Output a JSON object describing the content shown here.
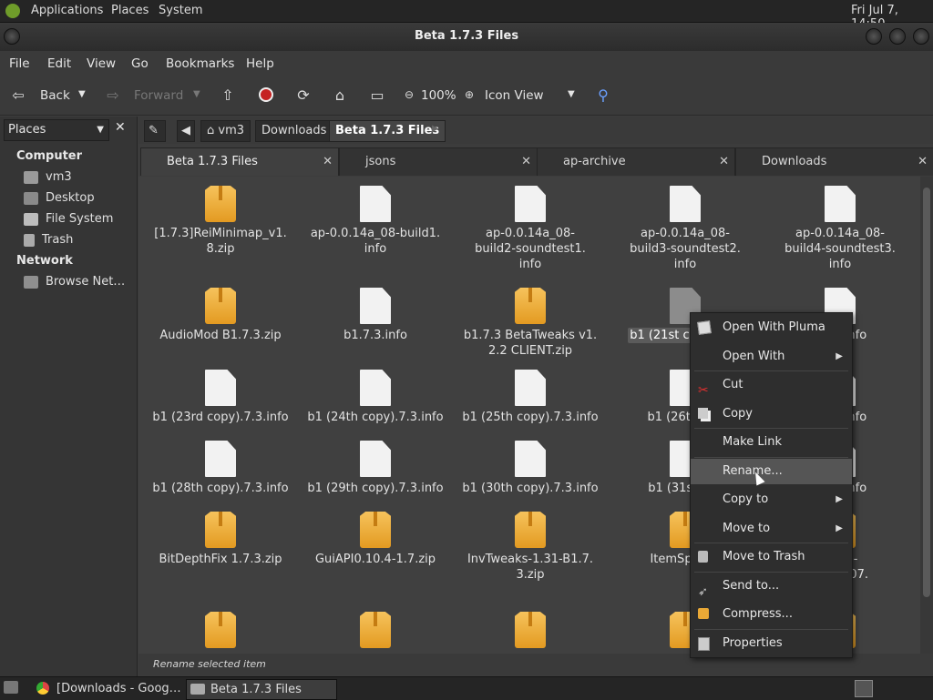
{
  "top_panel": {
    "menus": [
      "Applications",
      "Places",
      "System"
    ],
    "clock": "Fri Jul  7, 14:50"
  },
  "window": {
    "title": "Beta 1.7.3 Files"
  },
  "menubar": [
    "File",
    "Edit",
    "View",
    "Go",
    "Bookmarks",
    "Help"
  ],
  "toolbar": {
    "back": "Back",
    "forward": "Forward",
    "zoom": "100%",
    "view_mode": "Icon View"
  },
  "sidebar": {
    "title": "Places",
    "sections": [
      {
        "heading": "Computer",
        "items": [
          "vm3",
          "Desktop",
          "File System",
          "Trash"
        ]
      },
      {
        "heading": "Network",
        "items": [
          "Browse Net…"
        ]
      }
    ]
  },
  "location": {
    "crumbs": [
      "vm3",
      "Downloads",
      "Beta 1.7.3 Files"
    ]
  },
  "tabs": [
    "Beta 1.7.3 Files",
    "jsons",
    "ap-archive",
    "Downloads"
  ],
  "files": [
    {
      "name": "[1.7.3]ReiMinimap_v1.\n8.zip",
      "type": "zip"
    },
    {
      "name": "ap-0.0.14a_08-build1.\ninfo",
      "type": "doc"
    },
    {
      "name": "ap-0.0.14a_08-\nbuild2-soundtest1.\ninfo",
      "type": "doc"
    },
    {
      "name": "ap-0.0.14a_08-\nbuild3-soundtest2.\ninfo",
      "type": "doc"
    },
    {
      "name": "ap-0.0.14a_08-\nbuild4-soundtest3.\ninfo",
      "type": "doc"
    },
    {
      "name": "AudioMod B1.7.3.zip",
      "type": "zip"
    },
    {
      "name": "b1.7.3.info",
      "type": "doc"
    },
    {
      "name": "b1.7.3 BetaTweaks v1.\n2.2 CLIENT.zip",
      "type": "zip"
    },
    {
      "name": "b1 (21st cop",
      "type": "doc-selected"
    },
    {
      "name": ").7.3.info",
      "type": "doc"
    },
    {
      "name": "b1 (23rd copy).7.3.info",
      "type": "doc"
    },
    {
      "name": "b1 (24th copy).7.3.info",
      "type": "doc"
    },
    {
      "name": "b1 (25th copy).7.3.info",
      "type": "doc"
    },
    {
      "name": "b1 (26th cop",
      "type": "doc"
    },
    {
      "name": ").7.3.info",
      "type": "doc"
    },
    {
      "name": "b1 (28th copy).7.3.info",
      "type": "doc"
    },
    {
      "name": "b1 (29th copy).7.3.info",
      "type": "doc"
    },
    {
      "name": "b1 (30th copy).7.3.info",
      "type": "doc"
    },
    {
      "name": "b1 (31st cop",
      "type": "doc"
    },
    {
      "name": ").7.3.info",
      "type": "doc"
    },
    {
      "name": "BitDepthFix 1.7.3.zip",
      "type": "zip"
    },
    {
      "name": "GuiAPI0.10.4-1.7.zip",
      "type": "zip"
    },
    {
      "name": "InvTweaks-1.31-B1.7.\n3.zip",
      "type": "zip"
    },
    {
      "name": "ItemSpriteA",
      "type": "zip"
    },
    {
      "name": "forge-\n0110907.",
      "type": "zip"
    },
    {
      "name": "",
      "type": "zip"
    },
    {
      "name": "",
      "type": "zip"
    },
    {
      "name": "",
      "type": "zip"
    },
    {
      "name": "",
      "type": "zip"
    },
    {
      "name": "",
      "type": "zip"
    }
  ],
  "context_menu": [
    {
      "label": "Open With Pluma",
      "icon": "pluma-icon",
      "submenu": false
    },
    {
      "label": "Open With",
      "icon": "",
      "submenu": true
    },
    {
      "label": "Cut",
      "icon": "scissors-icon",
      "submenu": false
    },
    {
      "label": "Copy",
      "icon": "copy-icon",
      "submenu": false
    },
    {
      "label": "Make Link",
      "icon": "",
      "submenu": false
    },
    {
      "label": "Rename...",
      "icon": "",
      "submenu": false,
      "highlighted": true
    },
    {
      "label": "Copy to",
      "icon": "",
      "submenu": true
    },
    {
      "label": "Move to",
      "icon": "",
      "submenu": true
    },
    {
      "label": "Move to Trash",
      "icon": "trash-icon",
      "submenu": false
    },
    {
      "label": "Send to...",
      "icon": "send-icon",
      "submenu": false
    },
    {
      "label": "Compress...",
      "icon": "archive-icon",
      "submenu": false
    },
    {
      "label": "Properties",
      "icon": "properties-icon",
      "submenu": false
    }
  ],
  "status_text": "Rename selected item",
  "taskbar": [
    "[Downloads - Goog…",
    "Beta 1.7.3 Files"
  ]
}
